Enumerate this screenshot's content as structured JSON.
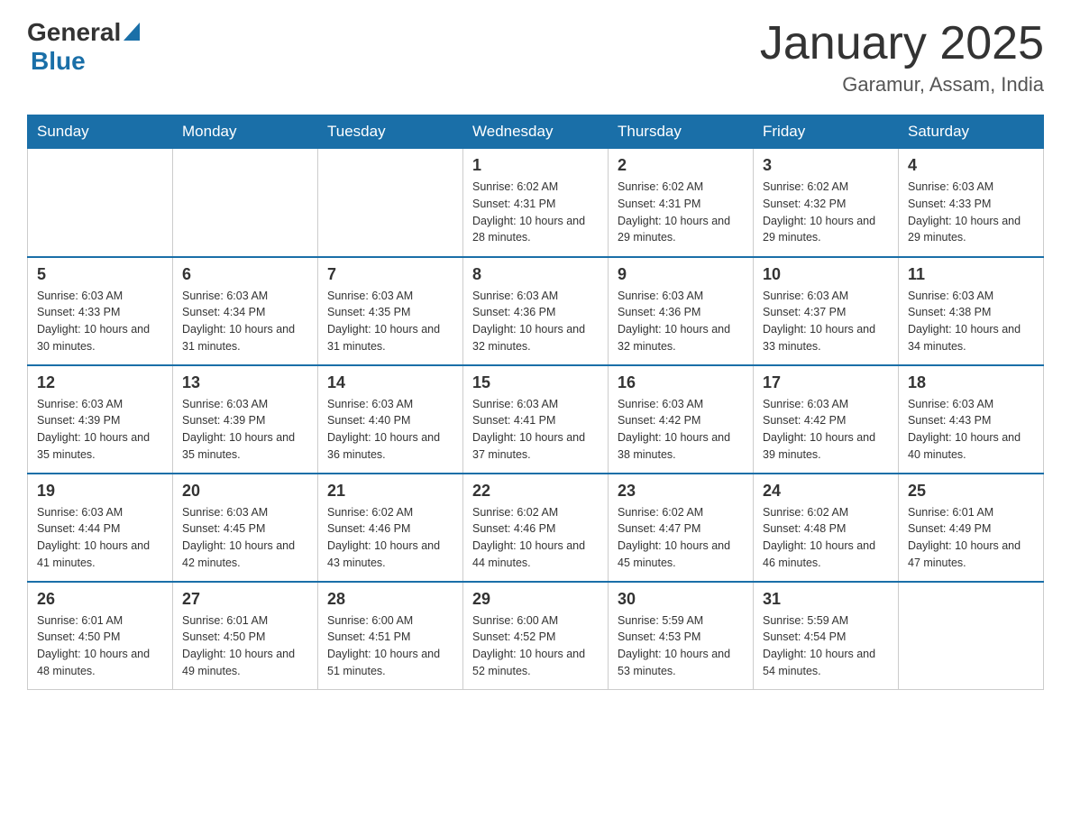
{
  "header": {
    "logo_general": "General",
    "logo_blue": "Blue",
    "title": "January 2025",
    "subtitle": "Garamur, Assam, India"
  },
  "days_of_week": [
    "Sunday",
    "Monday",
    "Tuesday",
    "Wednesday",
    "Thursday",
    "Friday",
    "Saturday"
  ],
  "weeks": [
    {
      "days": [
        {
          "number": "",
          "info": ""
        },
        {
          "number": "",
          "info": ""
        },
        {
          "number": "",
          "info": ""
        },
        {
          "number": "1",
          "info": "Sunrise: 6:02 AM\nSunset: 4:31 PM\nDaylight: 10 hours\nand 28 minutes."
        },
        {
          "number": "2",
          "info": "Sunrise: 6:02 AM\nSunset: 4:31 PM\nDaylight: 10 hours\nand 29 minutes."
        },
        {
          "number": "3",
          "info": "Sunrise: 6:02 AM\nSunset: 4:32 PM\nDaylight: 10 hours\nand 29 minutes."
        },
        {
          "number": "4",
          "info": "Sunrise: 6:03 AM\nSunset: 4:33 PM\nDaylight: 10 hours\nand 29 minutes."
        }
      ]
    },
    {
      "days": [
        {
          "number": "5",
          "info": "Sunrise: 6:03 AM\nSunset: 4:33 PM\nDaylight: 10 hours\nand 30 minutes."
        },
        {
          "number": "6",
          "info": "Sunrise: 6:03 AM\nSunset: 4:34 PM\nDaylight: 10 hours\nand 31 minutes."
        },
        {
          "number": "7",
          "info": "Sunrise: 6:03 AM\nSunset: 4:35 PM\nDaylight: 10 hours\nand 31 minutes."
        },
        {
          "number": "8",
          "info": "Sunrise: 6:03 AM\nSunset: 4:36 PM\nDaylight: 10 hours\nand 32 minutes."
        },
        {
          "number": "9",
          "info": "Sunrise: 6:03 AM\nSunset: 4:36 PM\nDaylight: 10 hours\nand 32 minutes."
        },
        {
          "number": "10",
          "info": "Sunrise: 6:03 AM\nSunset: 4:37 PM\nDaylight: 10 hours\nand 33 minutes."
        },
        {
          "number": "11",
          "info": "Sunrise: 6:03 AM\nSunset: 4:38 PM\nDaylight: 10 hours\nand 34 minutes."
        }
      ]
    },
    {
      "days": [
        {
          "number": "12",
          "info": "Sunrise: 6:03 AM\nSunset: 4:39 PM\nDaylight: 10 hours\nand 35 minutes."
        },
        {
          "number": "13",
          "info": "Sunrise: 6:03 AM\nSunset: 4:39 PM\nDaylight: 10 hours\nand 35 minutes."
        },
        {
          "number": "14",
          "info": "Sunrise: 6:03 AM\nSunset: 4:40 PM\nDaylight: 10 hours\nand 36 minutes."
        },
        {
          "number": "15",
          "info": "Sunrise: 6:03 AM\nSunset: 4:41 PM\nDaylight: 10 hours\nand 37 minutes."
        },
        {
          "number": "16",
          "info": "Sunrise: 6:03 AM\nSunset: 4:42 PM\nDaylight: 10 hours\nand 38 minutes."
        },
        {
          "number": "17",
          "info": "Sunrise: 6:03 AM\nSunset: 4:42 PM\nDaylight: 10 hours\nand 39 minutes."
        },
        {
          "number": "18",
          "info": "Sunrise: 6:03 AM\nSunset: 4:43 PM\nDaylight: 10 hours\nand 40 minutes."
        }
      ]
    },
    {
      "days": [
        {
          "number": "19",
          "info": "Sunrise: 6:03 AM\nSunset: 4:44 PM\nDaylight: 10 hours\nand 41 minutes."
        },
        {
          "number": "20",
          "info": "Sunrise: 6:03 AM\nSunset: 4:45 PM\nDaylight: 10 hours\nand 42 minutes."
        },
        {
          "number": "21",
          "info": "Sunrise: 6:02 AM\nSunset: 4:46 PM\nDaylight: 10 hours\nand 43 minutes."
        },
        {
          "number": "22",
          "info": "Sunrise: 6:02 AM\nSunset: 4:46 PM\nDaylight: 10 hours\nand 44 minutes."
        },
        {
          "number": "23",
          "info": "Sunrise: 6:02 AM\nSunset: 4:47 PM\nDaylight: 10 hours\nand 45 minutes."
        },
        {
          "number": "24",
          "info": "Sunrise: 6:02 AM\nSunset: 4:48 PM\nDaylight: 10 hours\nand 46 minutes."
        },
        {
          "number": "25",
          "info": "Sunrise: 6:01 AM\nSunset: 4:49 PM\nDaylight: 10 hours\nand 47 minutes."
        }
      ]
    },
    {
      "days": [
        {
          "number": "26",
          "info": "Sunrise: 6:01 AM\nSunset: 4:50 PM\nDaylight: 10 hours\nand 48 minutes."
        },
        {
          "number": "27",
          "info": "Sunrise: 6:01 AM\nSunset: 4:50 PM\nDaylight: 10 hours\nand 49 minutes."
        },
        {
          "number": "28",
          "info": "Sunrise: 6:00 AM\nSunset: 4:51 PM\nDaylight: 10 hours\nand 51 minutes."
        },
        {
          "number": "29",
          "info": "Sunrise: 6:00 AM\nSunset: 4:52 PM\nDaylight: 10 hours\nand 52 minutes."
        },
        {
          "number": "30",
          "info": "Sunrise: 5:59 AM\nSunset: 4:53 PM\nDaylight: 10 hours\nand 53 minutes."
        },
        {
          "number": "31",
          "info": "Sunrise: 5:59 AM\nSunset: 4:54 PM\nDaylight: 10 hours\nand 54 minutes."
        },
        {
          "number": "",
          "info": ""
        }
      ]
    }
  ]
}
